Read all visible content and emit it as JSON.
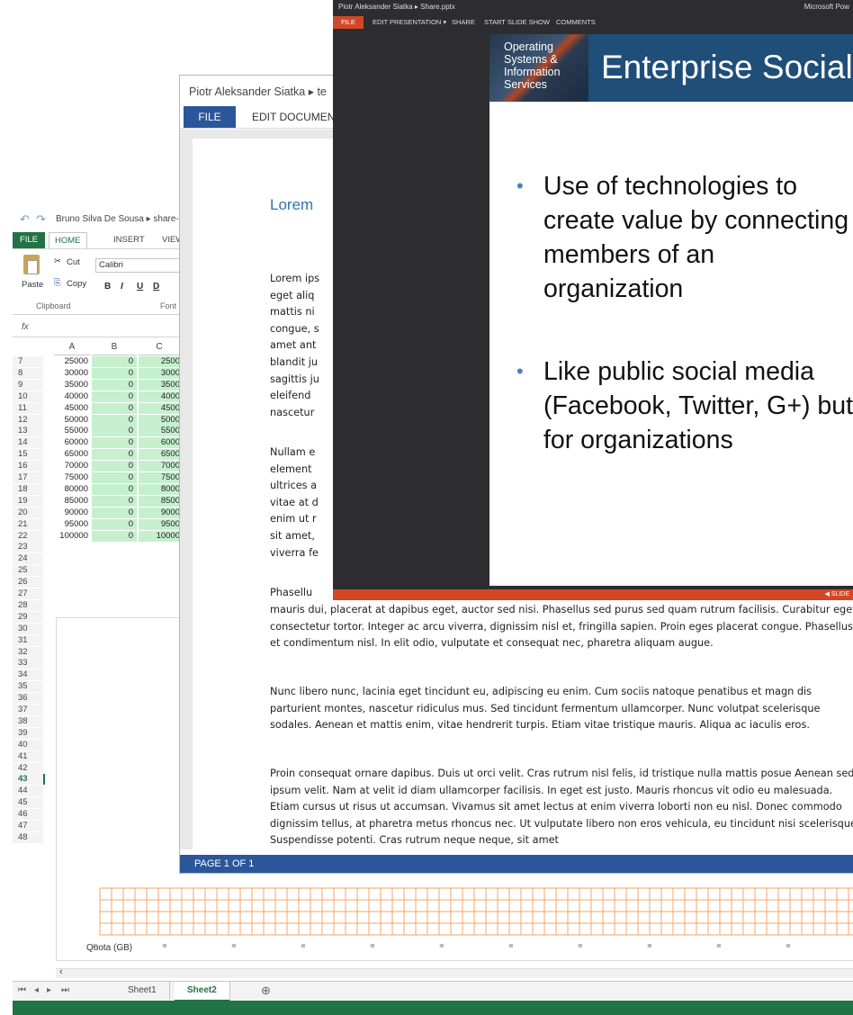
{
  "excel": {
    "breadcrumb": "Bruno Silva De Sousa ▸ share-c",
    "tabs": {
      "file": "FILE",
      "home": "HOME",
      "insert": "INSERT",
      "view": "VIEW"
    },
    "clipboard": {
      "cut": "Cut",
      "copy": "Copy",
      "paste": "Paste",
      "group_label": "Clipboard"
    },
    "font": {
      "name": "Calibri",
      "group_label": "Font",
      "bold": "B",
      "italic": "I",
      "underline": "U",
      "double_underline": "D"
    },
    "fx_label": "fx",
    "columns": [
      "A",
      "B",
      "C"
    ],
    "rows": [
      {
        "n": "7",
        "a": "25000",
        "b": "0",
        "c": "2500"
      },
      {
        "n": "8",
        "a": "30000",
        "b": "0",
        "c": "3000"
      },
      {
        "n": "9",
        "a": "35000",
        "b": "0",
        "c": "3500"
      },
      {
        "n": "10",
        "a": "40000",
        "b": "0",
        "c": "4000"
      },
      {
        "n": "11",
        "a": "45000",
        "b": "0",
        "c": "4500"
      },
      {
        "n": "12",
        "a": "50000",
        "b": "0",
        "c": "5000"
      },
      {
        "n": "13",
        "a": "55000",
        "b": "0",
        "c": "5500"
      },
      {
        "n": "14",
        "a": "60000",
        "b": "0",
        "c": "6000"
      },
      {
        "n": "15",
        "a": "65000",
        "b": "0",
        "c": "6500"
      },
      {
        "n": "16",
        "a": "70000",
        "b": "0",
        "c": "7000"
      },
      {
        "n": "17",
        "a": "75000",
        "b": "0",
        "c": "7500"
      },
      {
        "n": "18",
        "a": "80000",
        "b": "0",
        "c": "8000"
      },
      {
        "n": "19",
        "a": "85000",
        "b": "0",
        "c": "8500"
      },
      {
        "n": "20",
        "a": "90000",
        "b": "0",
        "c": "9000"
      },
      {
        "n": "21",
        "a": "95000",
        "b": "0",
        "c": "9500"
      },
      {
        "n": "22",
        "a": "100000",
        "b": "0",
        "c": "10000"
      }
    ],
    "empty_rows": [
      "23",
      "24",
      "25",
      "26",
      "27",
      "28",
      "29",
      "30",
      "31",
      "32",
      "33",
      "34",
      "35",
      "36",
      "37",
      "38",
      "39",
      "40",
      "41",
      "42",
      "43",
      "44",
      "45",
      "46",
      "47",
      "48"
    ],
    "selected_row": "43",
    "chart_axis_label": "Quota (GB)",
    "sheets": [
      "Sheet1",
      "Sheet2"
    ],
    "active_sheet": "Sheet2",
    "add_sheet": "⊕"
  },
  "word": {
    "breadcrumb": "Piotr Aleksander Siatka ▸ te",
    "tabs": {
      "file": "FILE",
      "edit": "EDIT DOCUMEN"
    },
    "heading": "Lorem",
    "para1_lines": [
      "Lorem ips",
      "eget aliq",
      "mattis ni",
      "congue, s",
      "amet ant",
      "blandit ju",
      "sagittis ju",
      "eleifend",
      "nascetur"
    ],
    "para2_lines": [
      "Nullam e",
      "element",
      "ultrices a",
      "vitae at d",
      "enim ut r",
      "sit amet,",
      "viverra fe"
    ],
    "para3_start": "Phasellu",
    "para3": "mauris dui, placerat at dapibus eget, auctor sed nisi. Phasellus sed purus sed quam rutrum facilisis. Curabitur eget consectetur tortor. Integer ac arcu viverra, dignissim nisl et, fringilla sapien. Proin eges placerat congue. Phasellus et condimentum nisl. In elit odio, vulputate et consequat nec, pharetra aliquam augue.",
    "para4": "Nunc libero nunc, lacinia eget tincidunt eu, adipiscing eu enim. Cum sociis natoque penatibus et magn dis parturient montes, nascetur ridiculus mus. Sed tincidunt fermentum ullamcorper. Nunc volutpat scelerisque sodales. Aenean et mattis enim, vitae hendrerit turpis. Etiam vitae tristique mauris. Aliqua ac iaculis eros.",
    "para5": "Proin consequat ornare dapibus. Duis ut orci velit. Cras rutrum nisl felis, id tristique nulla mattis posue Aenean sed ipsum velit. Nam at velit id diam ullamcorper facilisis. In eget est justo. Mauris rhoncus vit odio eu malesuada. Etiam cursus ut risus ut accumsan. Vivamus sit amet lectus at enim viverra loborti non eu nisl. Donec commodo dignissim tellus, at pharetra metus rhoncus nec. Ut vulputate libero non eros vehicula, eu tincidunt nisi scelerisque. Suspendisse potenti. Cras rutrum neque neque, sit amet",
    "status": "PAGE 1 OF 1"
  },
  "ppt": {
    "title_left": "Piotr Aleksander Siatka ▸ Share.pptx",
    "title_right": "Microsoft Pow",
    "menu": {
      "file": "FILE",
      "edit": "EDIT PRESENTATION ▾",
      "share": "SHARE",
      "slideshow": "START SLIDE SHOW",
      "comments": "COMMENTS"
    },
    "logo_lines": "Operating Systems & Information Services",
    "slide_title": "Enterprise Social",
    "bullets": [
      "Use of technologies to create value by connecting members of an organization",
      "Like public social media (Facebook, Twitter, G+) but for organizations"
    ],
    "bullet_glyph": "•",
    "status_right": "◀  SLIDE"
  },
  "colors": {
    "excel_green": "#217346",
    "word_blue": "#2b579a",
    "ppt_orange": "#d24726",
    "chart_grid": "#f4a46a"
  }
}
